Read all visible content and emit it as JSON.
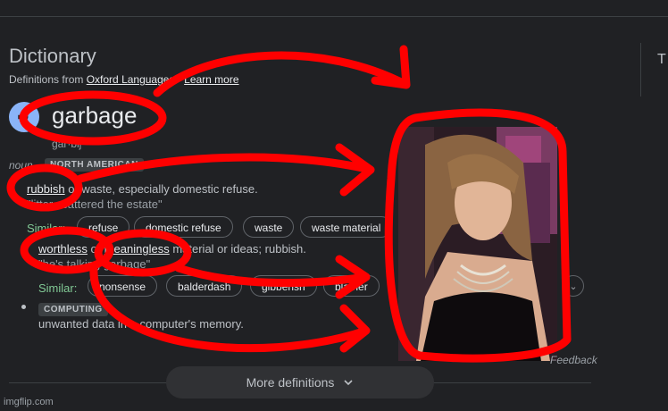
{
  "header": {
    "title": "Dictionary",
    "definitions_from": "Definitions from",
    "source_link": "Oxford Languages",
    "separator": "·",
    "learn_more": "Learn more",
    "side_letter": "T"
  },
  "entry": {
    "headword": "garbage",
    "phonetic": "gär·bij",
    "part_of_speech": "noun",
    "region_badge": "NORTH AMERICAN",
    "sense1": {
      "link": "rubbish",
      "text": " or waste, especially domestic refuse.",
      "example": "\"litter scattered the estate\"",
      "similar_label": "Similar:",
      "chips": [
        "refuse",
        "domestic refuse",
        "waste",
        "waste material"
      ]
    },
    "sense2": {
      "link1": "worthless",
      "mid": " or ",
      "link2": "meaningless",
      "text": " material or ideas; rubbish.",
      "example": "\"he's talking garbage\"",
      "similar_label": "Similar:",
      "chips": [
        "nonsense",
        "balderdash",
        "gibberish",
        "blather"
      ],
      "more_chip": "⌄"
    },
    "sense3": {
      "badge": "COMPUTING",
      "text": "unwanted data in a computer's memory."
    }
  },
  "feedback": "Feedback",
  "more_definitions": "More definitions",
  "watermark": "imgflip.com",
  "colors": {
    "background": "#202124",
    "annotation": "#ff0000",
    "similar": "#81c995",
    "speaker": "#8ab4f8"
  }
}
